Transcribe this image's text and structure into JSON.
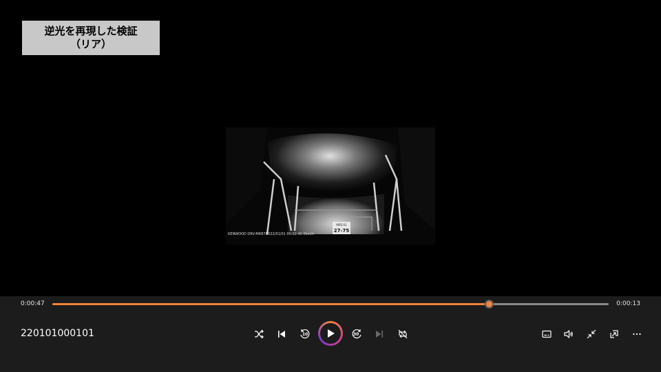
{
  "overlay_label": {
    "line1": "逆光を再現した検証",
    "line2": "（リア）",
    "background": "#c8c8c8"
  },
  "video": {
    "watermark_model": "KENWOOD DRV-MR870",
    "watermark_datetime": "2022/01/01 00:02:40 0km/h",
    "plate_top": "MRS:01",
    "plate_number": "27-75"
  },
  "player": {
    "elapsed": "0:00:47",
    "remaining": "0:00:13",
    "progress": 0.785,
    "file_name": "220101000101",
    "accent_color": "#f0833a",
    "skip_back_seconds": "10",
    "skip_forward_seconds": "30",
    "controls": {
      "shuffle": "shuffle-icon",
      "previous": "previous-icon",
      "skip_back": "rewind-10-icon",
      "play": "play-icon",
      "skip_forward": "forward-30-icon",
      "next": "next-icon",
      "repeat": "repeat-off-icon",
      "subtitles": "subtitles-icon",
      "volume": "volume-icon",
      "mini_view": "minimize-icon",
      "cast": "cast-icon",
      "more": "more-icon"
    }
  }
}
